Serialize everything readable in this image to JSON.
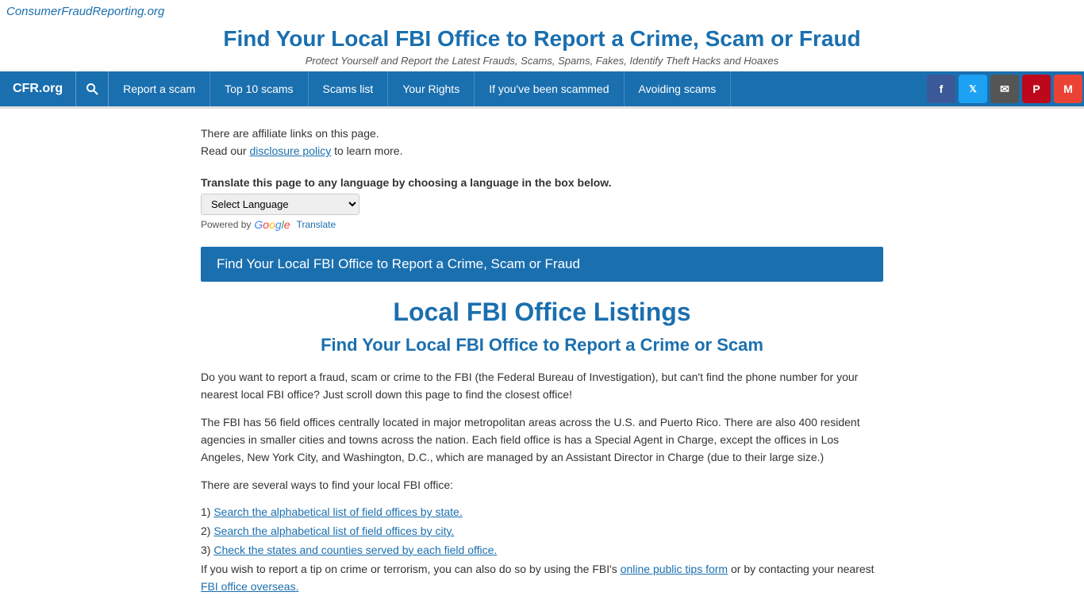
{
  "site": {
    "name": "ConsumerFraudReporting.org",
    "main_title": "Find Your Local FBI Office to Report a Crime, Scam or Fraud",
    "tagline": "Protect Yourself and Report the Latest Frauds, Scams, Spams, Fakes, Identify Theft Hacks and Hoaxes"
  },
  "navbar": {
    "logo": "CFR.org",
    "items": [
      {
        "id": "report-scam",
        "label": "Report a scam"
      },
      {
        "id": "top-10-scams",
        "label": "Top 10 scams"
      },
      {
        "id": "scams-list",
        "label": "Scams list"
      },
      {
        "id": "your-rights",
        "label": "Your Rights"
      },
      {
        "id": "if-scammed",
        "label": "If you've been scammed"
      },
      {
        "id": "avoiding-scams",
        "label": "Avoiding scams"
      }
    ]
  },
  "social": [
    {
      "id": "facebook",
      "label": "f",
      "class": "fb"
    },
    {
      "id": "twitter",
      "label": "t",
      "class": "tw"
    },
    {
      "id": "email",
      "label": "✉",
      "class": "em"
    },
    {
      "id": "pinterest",
      "label": "P",
      "class": "pi"
    },
    {
      "id": "gmail",
      "label": "M",
      "class": "gm"
    }
  ],
  "affiliate": {
    "line1": "There are affiliate links on this page.",
    "line2_before": "Read our ",
    "link_text": "disclosure policy",
    "line2_after": " to learn more."
  },
  "translate": {
    "label": "Translate this page to any language by choosing a language in the box below.",
    "select_default": "Select Language",
    "powered_by": "Powered by",
    "translate_label": "Translate"
  },
  "blue_banner": "Find Your Local FBI Office to Report a Crime, Scam or Fraud",
  "main": {
    "title": "Local FBI Office Listings",
    "subtitle": "Find Your Local FBI Office to Report a Crime or Scam",
    "para1": "Do you want to report a fraud, scam or crime to the FBI (the Federal Bureau of Investigation), but can't find the phone number for your nearest local FBI office?  Just scroll down this page to find the closest office!",
    "para2": "The FBI has 56 field offices centrally located in major metropolitan areas across the U.S. and Puerto Rico. There are also 400 resident agencies in smaller cities and towns across the nation. Each field office is has a Special Agent in Charge, except the offices in Los Angeles, New York City, and Washington, D.C., which are managed by an Assistant Director in Charge (due to their large size.)",
    "ways_intro": "There are several ways to find your local FBI office:",
    "ways": [
      {
        "num": "1)",
        "text_before": "",
        "link_text": "Search the alphabetical list of field offices by state.",
        "text_after": ""
      },
      {
        "num": "2)",
        "text_before": "",
        "link_text": "Search the alphabetical list of field offices by city.",
        "text_after": ""
      },
      {
        "num": "3)",
        "text_before": "",
        "link_text": "Check the states and counties served by each field office.",
        "text_after": ""
      }
    ],
    "para_tip_before": "If you wish to report a tip on crime or terrorism, you can also do so by using the FBI's ",
    "para_tip_link": "online public tips form",
    "para_tip_after": " or by contacting your nearest",
    "para_tip_end": "FBI office overseas."
  }
}
